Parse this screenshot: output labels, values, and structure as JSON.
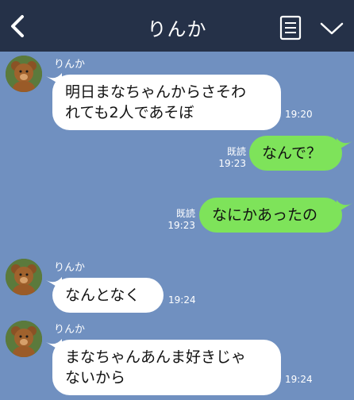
{
  "header": {
    "title": "りんか",
    "bg_color": "#253148"
  },
  "colors": {
    "chat_bg": "#7090c0",
    "incoming_bubble": "#ffffff",
    "outgoing_bubble": "#7ee35a"
  },
  "messages": [
    {
      "direction": "incoming",
      "sender": "りんか",
      "lines": [
        "明日まなちゃんからさそわ",
        "れても2人であそぼ"
      ],
      "time": "19:20"
    },
    {
      "direction": "outgoing",
      "text": "なんで？",
      "read": "既読",
      "time": "19:23"
    },
    {
      "direction": "outgoing",
      "text": "なにかあったの",
      "read": "既読",
      "time": "19:23"
    },
    {
      "direction": "incoming",
      "sender": "りんか",
      "text": "なんとなく",
      "time": "19:24"
    },
    {
      "direction": "incoming",
      "sender": "りんか",
      "lines": [
        "まなちゃんあんま好きじゃ",
        "ないから"
      ],
      "time": "19:24"
    }
  ]
}
